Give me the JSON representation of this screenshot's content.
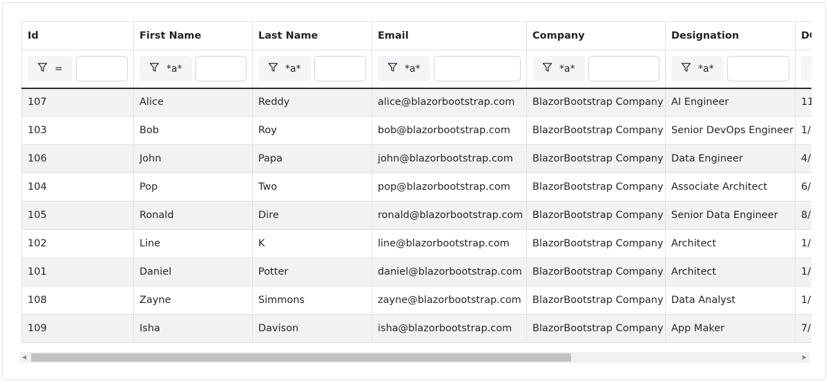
{
  "columns": [
    {
      "header": "Id",
      "filter_op": "="
    },
    {
      "header": "First Name",
      "filter_op": "*a*"
    },
    {
      "header": "Last Name",
      "filter_op": "*a*"
    },
    {
      "header": "Email",
      "filter_op": "*a*"
    },
    {
      "header": "Company",
      "filter_op": "*a*"
    },
    {
      "header": "Designation",
      "filter_op": "*a*"
    },
    {
      "header": "DO",
      "filter_op": ""
    }
  ],
  "rows": [
    [
      "107",
      "Alice",
      "Reddy",
      "alice@blazorbootstrap.com",
      "BlazorBootstrap Company",
      "AI Engineer",
      "11"
    ],
    [
      "103",
      "Bob",
      "Roy",
      "bob@blazorbootstrap.com",
      "BlazorBootstrap Company",
      "Senior DevOps Engineer",
      "1/"
    ],
    [
      "106",
      "John",
      "Papa",
      "john@blazorbootstrap.com",
      "BlazorBootstrap Company",
      "Data Engineer",
      "4/"
    ],
    [
      "104",
      "Pop",
      "Two",
      "pop@blazorbootstrap.com",
      "BlazorBootstrap Company",
      "Associate Architect",
      "6/"
    ],
    [
      "105",
      "Ronald",
      "Dire",
      "ronald@blazorbootstrap.com",
      "BlazorBootstrap Company",
      "Senior Data Engineer",
      "8/"
    ],
    [
      "102",
      "Line",
      "K",
      "line@blazorbootstrap.com",
      "BlazorBootstrap Company",
      "Architect",
      "1/"
    ],
    [
      "101",
      "Daniel",
      "Potter",
      "daniel@blazorbootstrap.com",
      "BlazorBootstrap Company",
      "Architect",
      "1/"
    ],
    [
      "108",
      "Zayne",
      "Simmons",
      "zayne@blazorbootstrap.com",
      "BlazorBootstrap Company",
      "Data Analyst",
      "1/"
    ],
    [
      "109",
      "Isha",
      "Davison",
      "isha@blazorbootstrap.com",
      "BlazorBootstrap Company",
      "App Maker",
      "7/"
    ]
  ],
  "scrollbar": {
    "position_fraction": 0.0,
    "visible_fraction": 0.68
  }
}
